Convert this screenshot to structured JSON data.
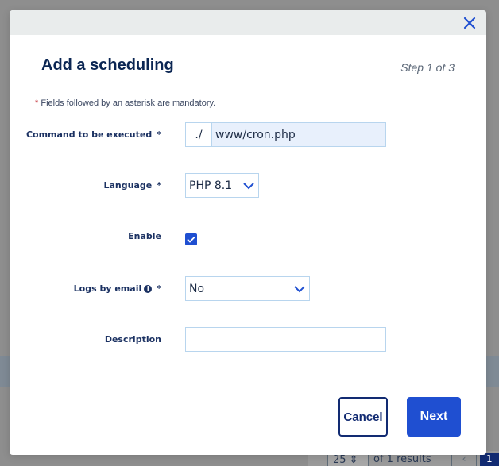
{
  "modal": {
    "title": "Add a scheduling",
    "step": "Step 1 of 3",
    "mandatory_note": "Fields followed by an asterisk are mandatory.",
    "asterisk": "*",
    "fields": {
      "command": {
        "label": "Command to be executed",
        "prefix": "./",
        "value": "www/cron.php"
      },
      "language": {
        "label": "Language",
        "selected": "PHP 8.1"
      },
      "enable": {
        "label": "Enable",
        "checked": true
      },
      "logs": {
        "label": "Logs by email",
        "selected": "No"
      },
      "description": {
        "label": "Description",
        "value": ""
      }
    },
    "buttons": {
      "cancel": "Cancel",
      "next": "Next"
    }
  },
  "background": {
    "pager": {
      "per_page": "25",
      "results": "of 1 results",
      "current_page": "1"
    }
  },
  "colors": {
    "primary": "#1f4fd1",
    "navy": "#122b72",
    "title": "#0b2653",
    "input_border": "#b8d5ee",
    "asterisk": "#c0252e"
  }
}
